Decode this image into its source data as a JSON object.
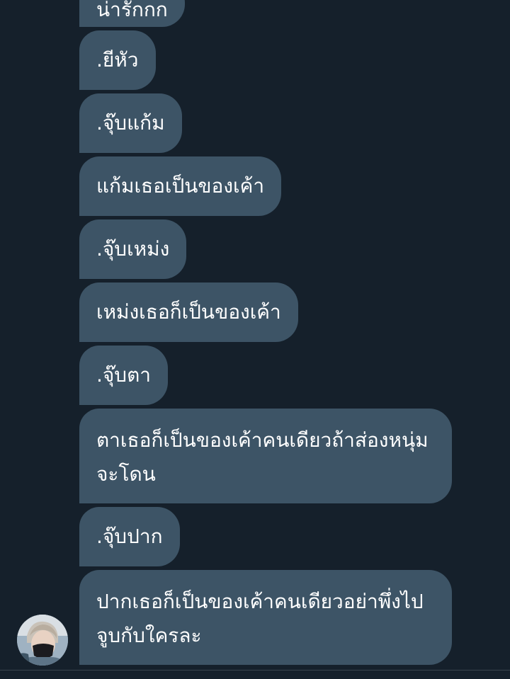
{
  "messages": [
    {
      "text": "น่ารักกก"
    },
    {
      "text": ".ยีหัว"
    },
    {
      "text": ".จุ๊บแก้ม"
    },
    {
      "text": "แก้มเธอเป็นของเค้า"
    },
    {
      "text": ".จุ๊บเหม่ง"
    },
    {
      "text": "เหม่งเธอก็เป็นของเค้า"
    },
    {
      "text": ".จุ๊บตา"
    },
    {
      "text": "ตาเธอก็เป็นของเค้าคนเดียวถ้าส่องหนุ่มจะโดน"
    },
    {
      "text": ".จุ๊บปาก"
    },
    {
      "text": "ปากเธอก็เป็นของเค้าคนเดียวอย่าพึ่งไปจูบกับใครละ"
    }
  ],
  "colors": {
    "background": "#15202b",
    "bubble": "#3d5466",
    "text": "#ffffff"
  },
  "avatar_icon": "user-avatar-photo"
}
